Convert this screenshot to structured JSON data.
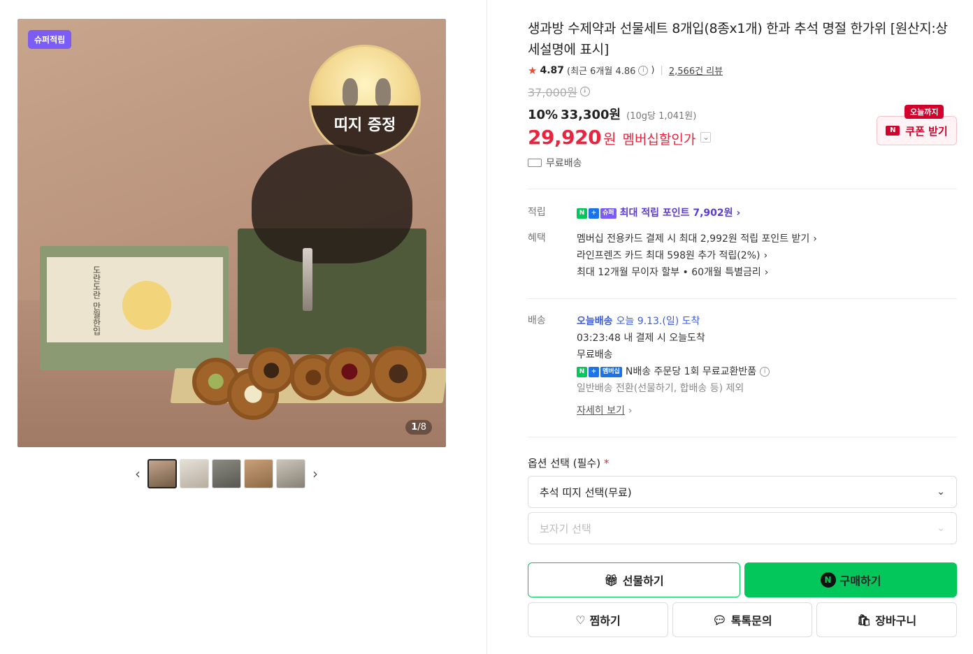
{
  "gallery": {
    "badge": "슈퍼적립",
    "medallion_text": "띠지 증정",
    "box_text": "도란도란 만월한입",
    "counter_current": "1",
    "counter_total": "/8"
  },
  "product": {
    "title": "생과방 수제약과 선물세트 8개입(8종x1개) 한과 추석 명절 한가위 [원산지:상세설명에 표시]",
    "rating": "4.87",
    "rating_recent": "(최근 6개월 4.86",
    "rating_recent_close": ")",
    "review_count": "2,566건 리뷰",
    "original_price": "37,000원",
    "discount_pct": "10%",
    "sale_price": "33,300원",
    "unit_price": "(10g당 1,041원)",
    "member_price": "29,920",
    "member_won": "원",
    "member_label": "멤버십할인가",
    "free_shipping": "무료배송"
  },
  "coupon": {
    "tag": "오늘까지",
    "icon": "N",
    "label": "쿠폰 받기"
  },
  "benefits": {
    "points_label": "적립",
    "points_text": "최대 적립 포인트 7,902원",
    "pill_n": "N",
    "pill_plus": "+",
    "pill_super": "슈퍼",
    "benefit_label": "혜택",
    "items": [
      "멤버십 전용카드 결제 시 최대 2,992원 적립 포인트 받기",
      "라인프렌즈 카드 최대 598원 추가 적립(2%)",
      "최대 12개월 무이자 할부 • 60개월 특별금리"
    ]
  },
  "delivery": {
    "label": "배송",
    "today_badge": "오늘배송",
    "arrival": "오늘 9.13.(일) 도착",
    "countdown": "03:23:48  내 결제 시 오늘도착",
    "free": "무료배송",
    "pill_member": "멤버십",
    "exchange": "N배송 주문당 1회 무료교환반품",
    "exclusion": "일반배송 전환(선물하기, 합배송 등) 제외",
    "details_link": "자세히 보기"
  },
  "options": {
    "title": "옵션 선택 (필수)",
    "required_mark": "*",
    "select1": "추석 띠지 선택(무료)",
    "select2": "보자기 선택"
  },
  "actions": {
    "gift": "선물하기",
    "buy": "구매하기",
    "buy_icon": "N",
    "wish": "찜하기",
    "talk": "톡톡문의",
    "cart": "장바구니"
  },
  "colors": {
    "accent_red": "#e8243f",
    "naver_green": "#03c75a",
    "super_purple": "#7b5cf5"
  }
}
